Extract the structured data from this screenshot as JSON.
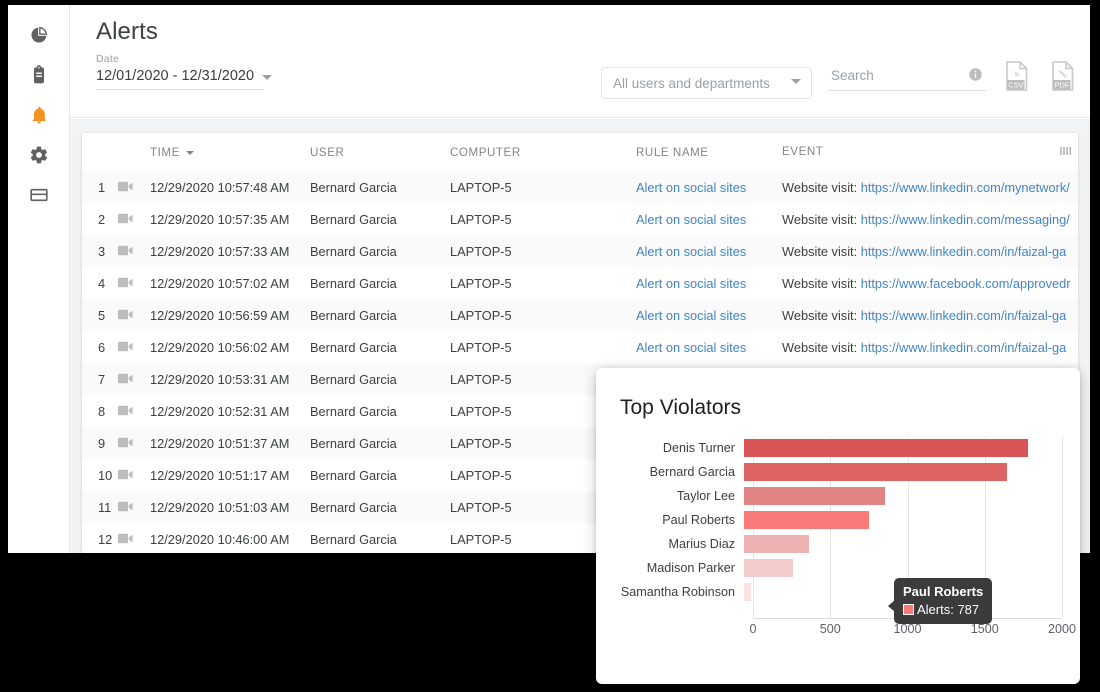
{
  "sidebar": {
    "items": [
      {
        "icon": "pie-chart-icon",
        "name": "dashboard",
        "active": false
      },
      {
        "icon": "clipboard-icon",
        "name": "reports",
        "active": false
      },
      {
        "icon": "bell-icon",
        "name": "alerts",
        "active": true
      },
      {
        "icon": "gear-icon",
        "name": "settings",
        "active": false
      },
      {
        "icon": "card-icon",
        "name": "billing",
        "active": false
      }
    ],
    "active_color": "#f59120",
    "inactive_color": "#616161"
  },
  "header": {
    "title": "Alerts",
    "date_label": "Date",
    "date_value": "12/01/2020 - 12/31/2020",
    "dept_filter": "All users and departments",
    "search_placeholder": "Search",
    "search_value": "",
    "info_icon": "info-icon",
    "csv_icon": "csv-export-icon",
    "pdf_icon": "pdf-export-icon"
  },
  "table": {
    "columns": [
      "",
      "",
      "TIME",
      "USER",
      "COMPUTER",
      "RULE NAME",
      "EVENT"
    ],
    "sorted_column": "TIME",
    "column_settings_icon": "column-settings-icon",
    "rows": [
      {
        "n": "1",
        "time": "12/29/2020 10:57:48 AM",
        "user": "Bernard Garcia",
        "computer": "LAPTOP-5",
        "rule": "Alert on social sites",
        "event_prefix": "Website visit: ",
        "event_url": "https://www.linkedin.com/mynetwork/"
      },
      {
        "n": "2",
        "time": "12/29/2020 10:57:35 AM",
        "user": "Bernard Garcia",
        "computer": "LAPTOP-5",
        "rule": "Alert on social sites",
        "event_prefix": "Website visit: ",
        "event_url": "https://www.linkedin.com/messaging/"
      },
      {
        "n": "3",
        "time": "12/29/2020 10:57:33 AM",
        "user": "Bernard Garcia",
        "computer": "LAPTOP-5",
        "rule": "Alert on social sites",
        "event_prefix": "Website visit: ",
        "event_url": "https://www.linkedin.com/in/faizal-ga"
      },
      {
        "n": "4",
        "time": "12/29/2020 10:57:02 AM",
        "user": "Bernard Garcia",
        "computer": "LAPTOP-5",
        "rule": "Alert on social sites",
        "event_prefix": "Website visit: ",
        "event_url": "https://www.facebook.com/approvedr"
      },
      {
        "n": "5",
        "time": "12/29/2020 10:56:59 AM",
        "user": "Bernard Garcia",
        "computer": "LAPTOP-5",
        "rule": "Alert on social sites",
        "event_prefix": "Website visit: ",
        "event_url": "https://www.linkedin.com/in/faizal-ga"
      },
      {
        "n": "6",
        "time": "12/29/2020 10:56:02 AM",
        "user": "Bernard Garcia",
        "computer": "LAPTOP-5",
        "rule": "Alert on social sites",
        "event_prefix": "Website visit: ",
        "event_url": "https://www.linkedin.com/in/faizal-ga"
      },
      {
        "n": "7",
        "time": "12/29/2020 10:53:31 AM",
        "user": "Bernard Garcia",
        "computer": "LAPTOP-5",
        "rule": "",
        "event_prefix": "",
        "event_url": ""
      },
      {
        "n": "8",
        "time": "12/29/2020 10:52:31 AM",
        "user": "Bernard Garcia",
        "computer": "LAPTOP-5",
        "rule": "",
        "event_prefix": "",
        "event_url": ""
      },
      {
        "n": "9",
        "time": "12/29/2020 10:51:37 AM",
        "user": "Bernard Garcia",
        "computer": "LAPTOP-5",
        "rule": "",
        "event_prefix": "",
        "event_url": ""
      },
      {
        "n": "10",
        "time": "12/29/2020 10:51:17 AM",
        "user": "Bernard Garcia",
        "computer": "LAPTOP-5",
        "rule": "",
        "event_prefix": "",
        "event_url": ""
      },
      {
        "n": "11",
        "time": "12/29/2020 10:51:03 AM",
        "user": "Bernard Garcia",
        "computer": "LAPTOP-5",
        "rule": "",
        "event_prefix": "",
        "event_url": ""
      },
      {
        "n": "12",
        "time": "12/29/2020 10:46:00 AM",
        "user": "Bernard Garcia",
        "computer": "LAPTOP-5",
        "rule": "",
        "event_prefix": "",
        "event_url": ""
      }
    ]
  },
  "chart_data": {
    "type": "bar",
    "orientation": "horizontal",
    "title": "Top Violators",
    "xlabel": "",
    "ylabel": "",
    "xlim": [
      0,
      2000
    ],
    "ticks": [
      0,
      500,
      1000,
      1500,
      2000
    ],
    "tick_labels": [
      "0",
      "500",
      "1000",
      "1500",
      "2000"
    ],
    "grid": true,
    "legend": false,
    "series_name": "Alerts",
    "categories": [
      "Denis Turner",
      "Bernard Garcia",
      "Taylor Lee",
      "Paul Roberts",
      "Marius Diaz",
      "Madison Parker",
      "Samantha Robinson"
    ],
    "values": [
      1785,
      1655,
      889,
      787,
      408,
      307,
      47
    ],
    "colors": [
      "#d95656",
      "#de6464",
      "#e18484",
      "#fa7a7a",
      "#edb2b2",
      "#f3cccc",
      "#fae2e2"
    ]
  },
  "tooltip": {
    "title": "Paul Roberts",
    "text": "Alerts: 787",
    "swatch_color": "#fa7a7a",
    "background": "#3b3b3b"
  }
}
